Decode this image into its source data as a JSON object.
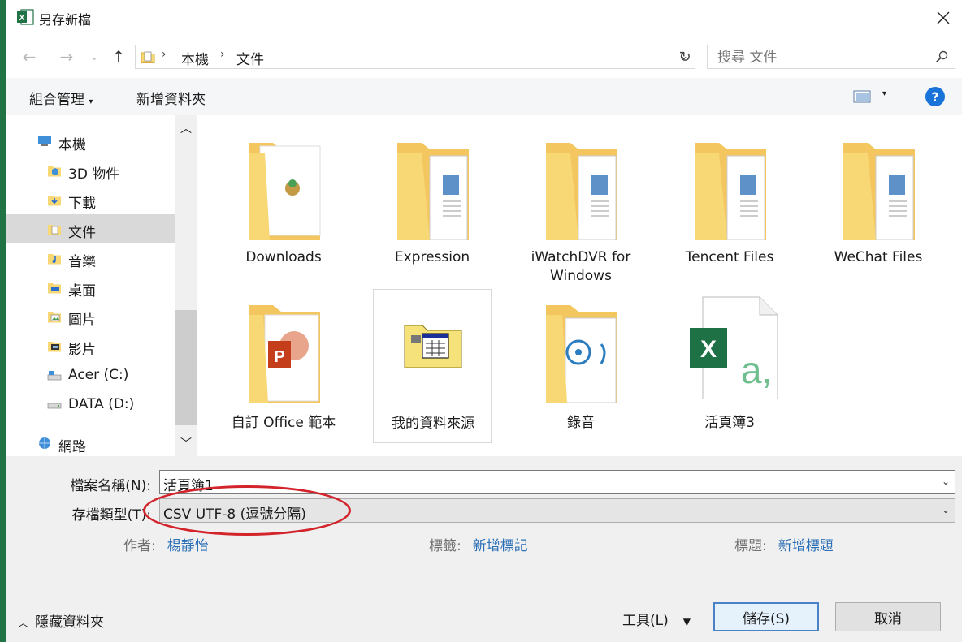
{
  "window": {
    "title": "另存新檔"
  },
  "nav": {
    "breadcrumb": [
      "本機",
      "文件"
    ]
  },
  "search": {
    "placeholder": "搜尋 文件"
  },
  "toolbar": {
    "organize": "組合管理",
    "new_folder": "新增資料夾"
  },
  "sidebar": {
    "items": [
      {
        "label": "本機",
        "icon": "computer-icon"
      },
      {
        "label": "3D 物件",
        "icon": "3d-objects-icon"
      },
      {
        "label": "下載",
        "icon": "downloads-folder-icon"
      },
      {
        "label": "文件",
        "icon": "documents-folder-icon",
        "selected": true
      },
      {
        "label": "音樂",
        "icon": "music-folder-icon"
      },
      {
        "label": "桌面",
        "icon": "desktop-folder-icon"
      },
      {
        "label": "圖片",
        "icon": "pictures-folder-icon"
      },
      {
        "label": "影片",
        "icon": "videos-folder-icon"
      },
      {
        "label": "Acer (C:)",
        "icon": "drive-c-icon"
      },
      {
        "label": "DATA (D:)",
        "icon": "drive-d-icon"
      },
      {
        "label": "網路",
        "icon": "network-icon"
      }
    ]
  },
  "files": [
    {
      "name": "Downloads",
      "type": "folder"
    },
    {
      "name": "Expression",
      "type": "folder"
    },
    {
      "name": "iWatchDVR for Windows",
      "type": "folder"
    },
    {
      "name": "Tencent Files",
      "type": "folder"
    },
    {
      "name": "WeChat Files",
      "type": "folder"
    },
    {
      "name": "自訂 Office 範本",
      "type": "folder"
    },
    {
      "name": "我的資料來源",
      "type": "data-source-folder"
    },
    {
      "name": "錄音",
      "type": "folder"
    },
    {
      "name": "活頁簿3",
      "type": "excel-file"
    }
  ],
  "form": {
    "filename_label": "檔案名稱(N):",
    "filename_value": "活頁簿1",
    "filetype_label": "存檔類型(T):",
    "filetype_value": "CSV UTF-8 (逗號分隔)",
    "author_label": "作者:",
    "author_value": "楊靜怡",
    "tags_label": "標籤:",
    "tags_value": "新增標記",
    "title_label": "標題:",
    "title_value": "新增標題"
  },
  "footer": {
    "hide_folders": "隱藏資料夾",
    "tools": "工具(L)",
    "save": "儲存(S)",
    "cancel": "取消"
  },
  "colors": {
    "excel_green": "#217346",
    "folder_yellow": "#f8d775",
    "highlight_oval": "#d3242b",
    "link_blue": "#2b6fb6"
  }
}
